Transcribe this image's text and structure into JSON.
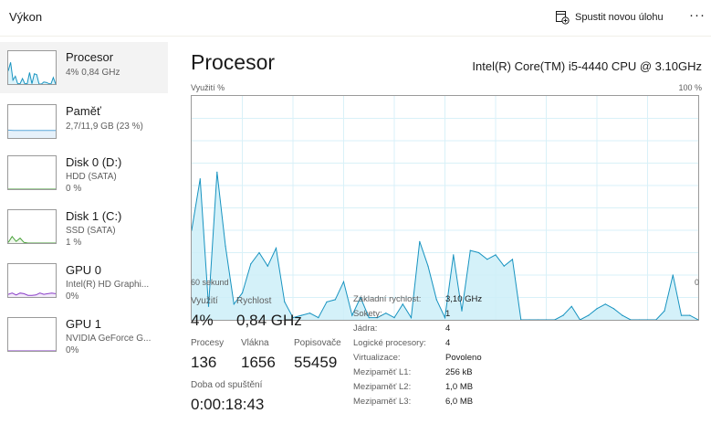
{
  "header": {
    "title": "Výkon",
    "new_task_label": "Spustit novou úlohu",
    "more_label": "···"
  },
  "sidebar": {
    "items": [
      {
        "name": "Procesor",
        "sub1": "4% 0,84 GHz",
        "sub2": "",
        "selected": true,
        "color": "#1793c0",
        "fill": "#dcf3fa"
      },
      {
        "name": "Paměť",
        "sub1": "2,7/11,9 GB (23 %)",
        "sub2": "",
        "selected": false,
        "color": "#5aa7d9",
        "fill": "#e6f1fa"
      },
      {
        "name": "Disk 0 (D:)",
        "sub1": "HDD (SATA)",
        "sub2": "0 %",
        "selected": false,
        "color": "#4aa23a",
        "fill": "#eff7ec"
      },
      {
        "name": "Disk 1 (C:)",
        "sub1": "SSD (SATA)",
        "sub2": "1 %",
        "selected": false,
        "color": "#4aa23a",
        "fill": "#eff7ec"
      },
      {
        "name": "GPU 0",
        "sub1": "Intel(R) HD Graphi...",
        "sub2": "0%",
        "selected": false,
        "color": "#8a3ec8",
        "fill": "#f3ebfa"
      },
      {
        "name": "GPU 1",
        "sub1": "NVIDIA GeForce G...",
        "sub2": "0%",
        "selected": false,
        "color": "#8a3ec8",
        "fill": "#f3ebfa"
      }
    ]
  },
  "main": {
    "title": "Procesor",
    "model": "Intel(R) Core(TM) i5-4440 CPU @ 3.10GHz",
    "util_label": "Využití %",
    "util_max": "100 %",
    "time_left": "60 sekund",
    "time_right": "0",
    "graph_color": "#1793c0",
    "graph_fill": "#cdeef8",
    "graph_grid": "#d9f1f8"
  },
  "stats": {
    "usage_label": "Využití",
    "usage_value": "4%",
    "speed_label": "Rychlost",
    "speed_value": "0,84 GHz",
    "processes_label": "Procesy",
    "processes_value": "136",
    "threads_label": "Vlákna",
    "threads_value": "1656",
    "handles_label": "Popisovače",
    "handles_value": "55459",
    "uptime_label": "Doba od spuštění",
    "uptime_value": "0:00:18:43"
  },
  "details": [
    {
      "key": "Základní rychlost:",
      "value": "3,10 GHz"
    },
    {
      "key": "Sokety:",
      "value": "1"
    },
    {
      "key": "Jádra:",
      "value": "4"
    },
    {
      "key": "Logické procesory:",
      "value": "4"
    },
    {
      "key": "Virtualizace:",
      "value": "Povoleno"
    },
    {
      "key": "Mezipaměť L1:",
      "value": "256 kB"
    },
    {
      "key": "Mezipaměť L2:",
      "value": "1,0 MB"
    },
    {
      "key": "Mezipaměť L3:",
      "value": "6,0 MB"
    }
  ],
  "chart_data": {
    "type": "area",
    "ylim": [
      0,
      100
    ],
    "grid": true,
    "x": [
      60,
      59,
      58,
      57,
      56,
      55,
      54,
      53,
      52,
      51,
      50,
      49,
      48,
      47,
      46,
      45,
      44,
      43,
      42,
      41,
      40,
      39,
      38,
      37,
      36,
      35,
      34,
      33,
      32,
      31,
      30,
      29,
      28,
      27,
      26,
      25,
      24,
      23,
      22,
      21,
      20,
      19,
      18,
      17,
      16,
      15,
      14,
      13,
      12,
      11,
      10,
      9,
      8,
      7,
      6,
      5,
      4,
      3,
      2,
      1,
      0
    ],
    "series": [
      {
        "values": [
          40,
          63,
          6,
          66,
          33,
          7,
          12,
          25,
          30,
          24,
          32,
          8,
          1,
          2,
          3,
          1,
          8,
          9,
          17,
          2,
          10,
          1,
          1,
          3,
          1,
          7,
          1,
          35,
          24,
          9,
          1,
          29,
          4,
          31,
          30,
          27,
          29,
          24,
          27,
          0,
          0,
          0,
          0,
          0,
          2,
          6,
          0,
          2,
          5,
          7,
          5,
          2,
          0,
          0,
          0,
          0,
          4,
          20,
          2,
          2,
          0
        ]
      }
    ]
  }
}
